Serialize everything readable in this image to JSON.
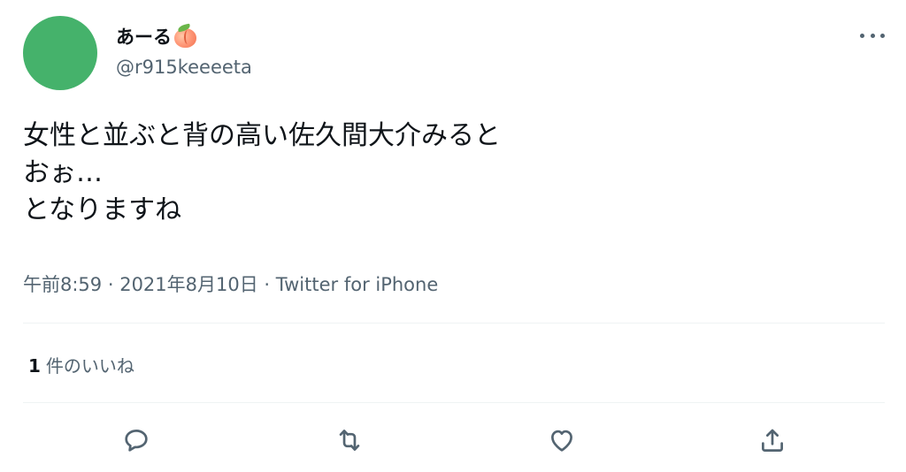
{
  "author": {
    "display_name": "あーる",
    "emoji_icon": "peach-icon",
    "handle": "@r915keeeeta",
    "avatar_color": "#45b26b"
  },
  "tweet": {
    "text": "女性と並ぶと背の高い佐久間大介みると\nおぉ…\nとなりますね"
  },
  "meta": {
    "time": "午前8:59",
    "separator": " · ",
    "date": "2021年8月10日",
    "source": "Twitter for iPhone"
  },
  "stats": {
    "likes_count": "1",
    "likes_label": "件のいいね"
  },
  "actions": [
    {
      "icon": "reply-icon"
    },
    {
      "icon": "retweet-icon"
    },
    {
      "icon": "like-icon"
    },
    {
      "icon": "share-icon"
    }
  ],
  "colors": {
    "text_primary": "#0f1419",
    "text_secondary": "#536471",
    "divider": "#eff3f4"
  }
}
